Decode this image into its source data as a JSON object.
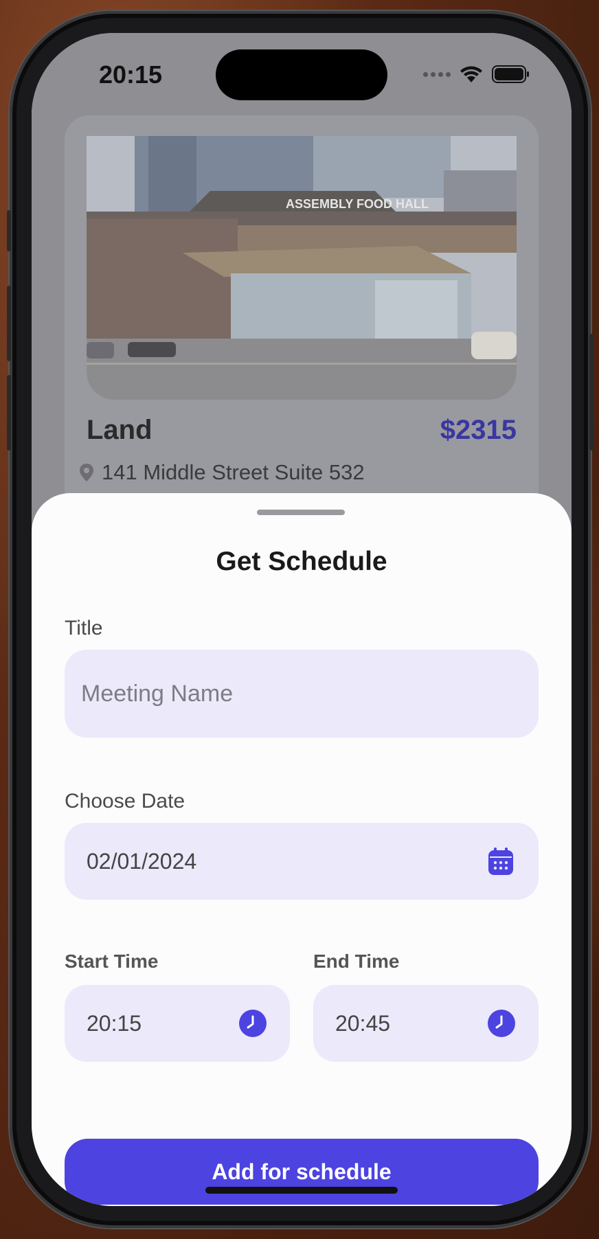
{
  "status_bar": {
    "time": "20:15"
  },
  "card": {
    "title": "Land",
    "price": "$2315",
    "address": "141 Middle Street Suite 532",
    "image_sign": "ASSEMBLY FOOD HALL"
  },
  "sheet": {
    "title": "Get Schedule",
    "title_label": "Title",
    "title_placeholder": "Meeting Name",
    "date_label": "Choose Date",
    "date_value": "02/01/2024",
    "start_label": "Start Time",
    "start_value": "20:15",
    "end_label": "End Time",
    "end_value": "20:45",
    "submit_label": "Add for schedule"
  },
  "colors": {
    "accent": "#4c43e0",
    "field_bg": "#ebe9fa",
    "price": "#3a36a0"
  },
  "icons": {
    "location": "location-pin-icon",
    "calendar": "calendar-icon",
    "clock": "clock-icon"
  }
}
